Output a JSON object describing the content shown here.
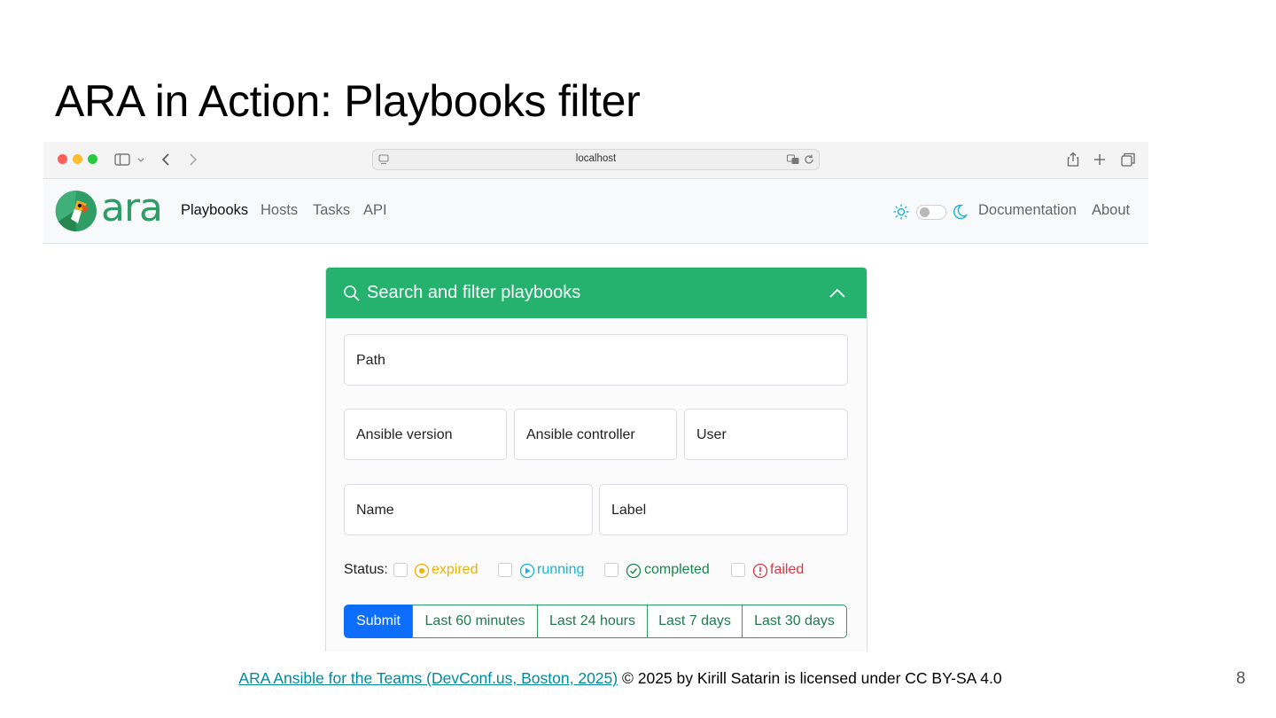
{
  "slide": {
    "title": "ARA in Action: Playbooks filter",
    "footer_link": "ARA Ansible for the Teams (DevConf.us, Boston, 2025)",
    "footer_rest": " © 2025 by Kirill Satarin is licensed under CC BY-SA 4.0",
    "page_number": "8"
  },
  "browser": {
    "url": "localhost",
    "icons": [
      "sidebar-icon",
      "chevron-down-icon",
      "back-icon",
      "forward-icon",
      "page-icon",
      "translate-icon",
      "reload-icon",
      "share-icon",
      "new-tab-icon",
      "tabs-overview-icon"
    ]
  },
  "navbar": {
    "logo_text": "ara",
    "links": [
      "Playbooks",
      "Hosts",
      "Tasks",
      "API"
    ],
    "active": "Playbooks",
    "right_links": [
      "Documentation",
      "About"
    ]
  },
  "filter_card": {
    "title": "Search and filter playbooks",
    "fields": {
      "path": "Path",
      "ansible_version": "Ansible version",
      "ansible_controller": "Ansible controller",
      "user": "User",
      "name": "Name",
      "label": "Label"
    },
    "status": {
      "label": "Status:",
      "options": [
        {
          "label": "expired",
          "color": "#f0b100"
        },
        {
          "label": "running",
          "color": "#17b5d6"
        },
        {
          "label": "completed",
          "color": "#19864f"
        },
        {
          "label": "failed",
          "color": "#dc3545"
        }
      ]
    },
    "buttons": {
      "submit": "Submit",
      "ranges": [
        "Last 60 minutes",
        "Last 24 hours",
        "Last 7 days",
        "Last 30 days"
      ]
    }
  },
  "colors": {
    "header_green": "#24b26e",
    "primary_blue": "#0d6efd",
    "logo_green": "#2f9e66"
  }
}
